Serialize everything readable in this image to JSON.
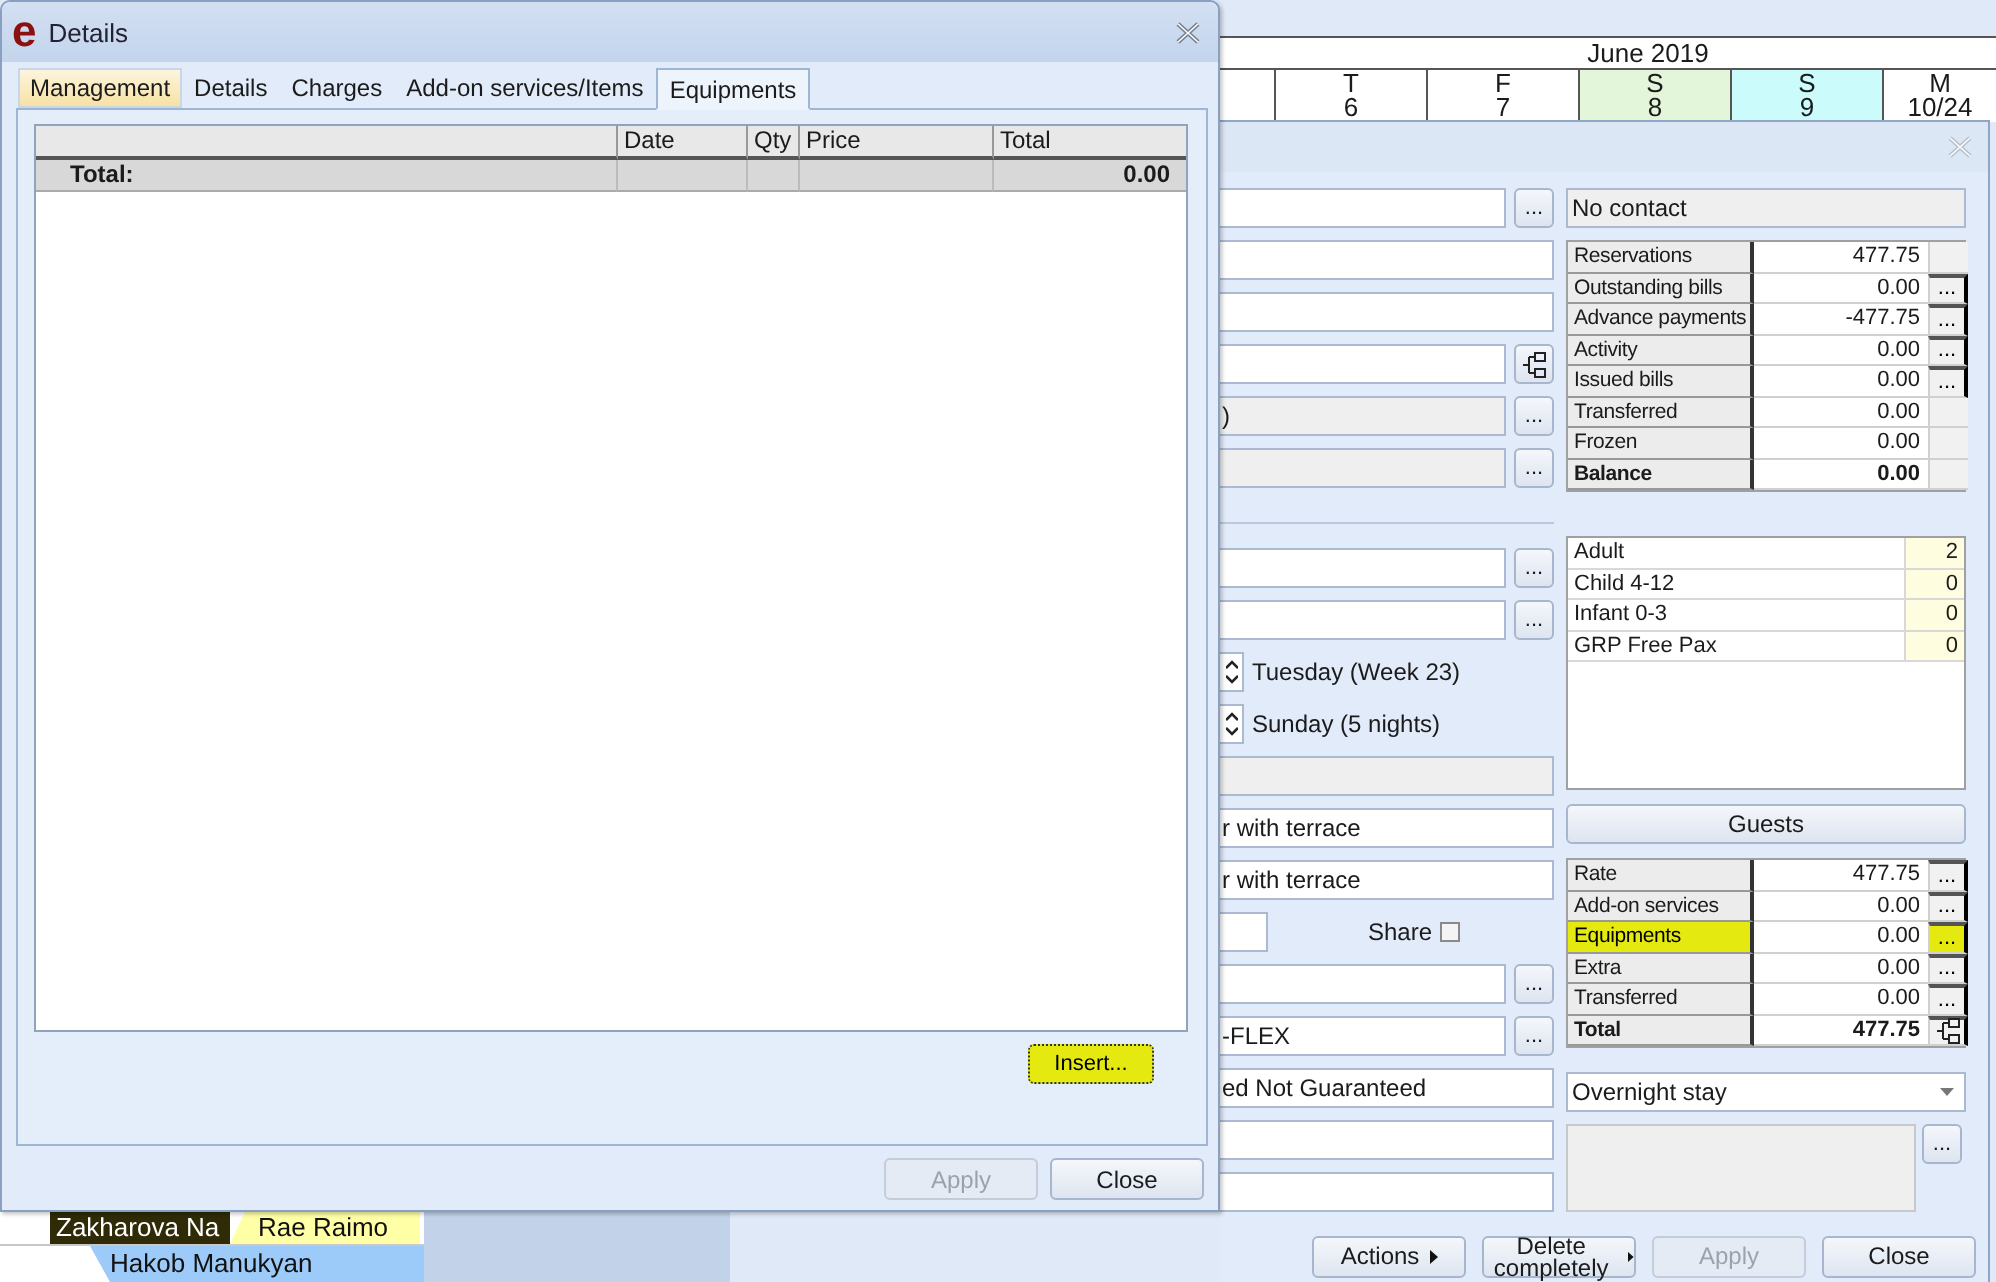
{
  "scheduler": {
    "month": "June 2019",
    "days": [
      {
        "weekday": "T",
        "date": "6",
        "color": "#ffffff"
      },
      {
        "weekday": "F",
        "date": "7",
        "color": "#ffffff"
      },
      {
        "weekday": "S",
        "date": "8",
        "color": "#e4f6da"
      },
      {
        "weekday": "S",
        "date": "9",
        "color": "#ccfbfb"
      },
      {
        "weekday": "M",
        "date": "10/24",
        "color": "#ffffff"
      }
    ],
    "lanes": [
      {
        "bookings": [
          {
            "guest": "Zakharova Na",
            "color": "#2e2b06"
          },
          {
            "guest": "Rae Raimo",
            "color": "#ffffa6"
          }
        ]
      },
      {
        "bookings": [
          {
            "guest": "Hakob Manukyan",
            "color": "#9dcbf9"
          }
        ]
      }
    ]
  },
  "reservation": {
    "left_fields": [
      {
        "kind": "field",
        "button": "..."
      },
      {
        "kind": "field"
      },
      {
        "kind": "field"
      },
      {
        "kind": "tree_field"
      },
      {
        "kind": "readonly",
        "value": ")",
        "button": "..."
      },
      {
        "kind": "readonly",
        "button": "..."
      },
      {
        "kind": "divider"
      },
      {
        "kind": "field",
        "button": "..."
      },
      {
        "kind": "field",
        "button": "..."
      },
      {
        "kind": "spinner",
        "label": "Tuesday (Week 23)"
      },
      {
        "kind": "spinner",
        "label": "Sunday (5 nights)"
      },
      {
        "kind": "readonly"
      },
      {
        "kind": "field",
        "value": "r with terrace"
      },
      {
        "kind": "field",
        "value": "r with terrace"
      },
      {
        "kind": "share",
        "label": "Share",
        "checked": false
      },
      {
        "kind": "field",
        "button": "..."
      },
      {
        "kind": "field",
        "value": "-FLEX",
        "button": "..."
      },
      {
        "kind": "field",
        "value": "ed Not Guaranteed"
      },
      {
        "kind": "field"
      },
      {
        "kind": "field"
      }
    ],
    "contact": "No contact",
    "balances": [
      {
        "label": "Reservations",
        "value": "477.75",
        "kind": "line"
      },
      {
        "label": "Outstanding bills",
        "value": "0.00",
        "button": "...",
        "kind": "line"
      },
      {
        "label": "Advance payments",
        "value": "-477.75",
        "button": "...",
        "kind": "line"
      },
      {
        "label": "Activity",
        "value": "0.00",
        "button": "...",
        "kind": "line"
      },
      {
        "label": "Issued bills",
        "value": "0.00",
        "button": "...",
        "kind": "line"
      },
      {
        "label": "Transferred",
        "value": "0.00",
        "kind": "line"
      },
      {
        "label": "Frozen",
        "value": "0.00",
        "kind": "line"
      },
      {
        "label": "Balance",
        "value": "0.00",
        "kind": "total"
      }
    ],
    "guests": [
      {
        "label": "Adult",
        "count": "2"
      },
      {
        "label": "Child 4-12",
        "count": "0"
      },
      {
        "label": "Infant 0-3",
        "count": "0"
      },
      {
        "label": "GRP Free Pax",
        "count": "0"
      }
    ],
    "guests_button": "Guests",
    "charges": [
      {
        "label": "Rate",
        "value": "477.75",
        "button": "...",
        "highlighted": false
      },
      {
        "label": "Add-on services",
        "value": "0.00",
        "button": "...",
        "highlighted": false
      },
      {
        "label": "Equipments",
        "value": "0.00",
        "button": "...",
        "highlighted": true
      },
      {
        "label": "Extra",
        "value": "0.00",
        "button": "...",
        "highlighted": false
      },
      {
        "label": "Transferred",
        "value": "0.00",
        "button": "...",
        "highlighted": false
      },
      {
        "label": "Total",
        "value": "477.75",
        "kind": "total",
        "highlighted": false
      }
    ],
    "stay_type": "Overnight stay",
    "notes_button": "...",
    "buttons": [
      {
        "label": "Actions",
        "disabled": false,
        "menu": true
      },
      {
        "label": "Delete completely",
        "disabled": false,
        "menu": true
      },
      {
        "label": "Apply",
        "disabled": true,
        "menu": false
      },
      {
        "label": "Close",
        "disabled": false,
        "menu": false
      }
    ]
  },
  "details": {
    "logo": "e",
    "title": "Details",
    "tabs": [
      {
        "label": "Management",
        "selected": false,
        "focused": true
      },
      {
        "label": "Details",
        "selected": false,
        "focused": false
      },
      {
        "label": "Charges",
        "selected": false,
        "focused": false
      },
      {
        "label": "Add-on services/Items",
        "selected": false,
        "focused": false
      },
      {
        "label": "Equipments",
        "selected": true,
        "focused": false
      }
    ],
    "table": {
      "columns": [
        "Date",
        "Qty",
        "Price",
        "Total"
      ],
      "total_row": {
        "label": "Total:",
        "value": "0.00"
      }
    },
    "insert_button": {
      "label": "Insert...",
      "highlighted": true
    },
    "buttons": [
      {
        "label": "Apply",
        "disabled": true
      },
      {
        "label": "Close",
        "disabled": false
      }
    ]
  }
}
